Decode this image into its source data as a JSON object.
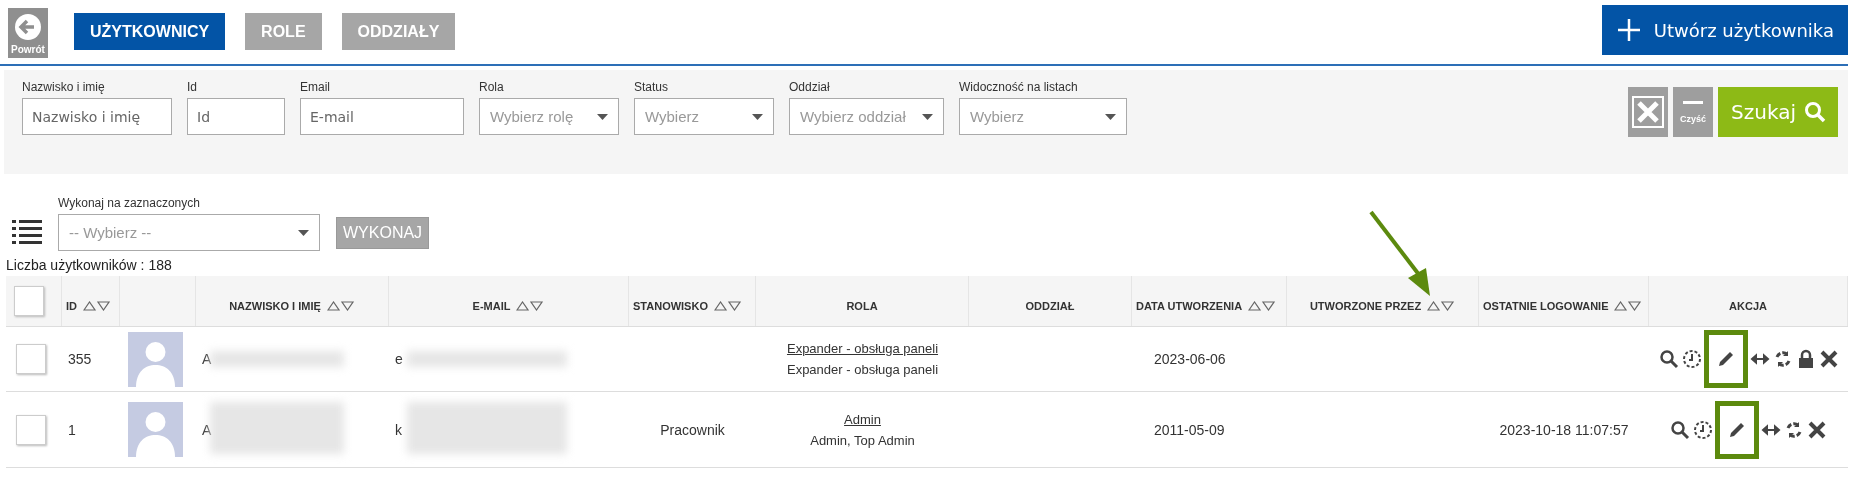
{
  "back_button": {
    "label": "Powrót"
  },
  "nav_tabs": [
    {
      "label": "UŻYTKOWNICY",
      "selected": true
    },
    {
      "label": "ROLE",
      "selected": false
    },
    {
      "label": "ODDZIAŁY",
      "selected": false
    }
  ],
  "create_button": {
    "label": "Utwórz użytkownika"
  },
  "filters": [
    {
      "kind": "text",
      "label": "Nazwisko i imię",
      "placeholder": "Nazwisko i imię"
    },
    {
      "kind": "text",
      "label": "Id",
      "placeholder": "Id"
    },
    {
      "kind": "text",
      "label": "Email",
      "placeholder": "E-mail"
    },
    {
      "kind": "select",
      "label": "Rola",
      "placeholder": "Wybierz rolę"
    },
    {
      "kind": "select",
      "label": "Status",
      "placeholder": "Wybierz"
    },
    {
      "kind": "select",
      "label": "Oddział",
      "placeholder": "Wybierz oddział"
    },
    {
      "kind": "select",
      "label": "Widoczność na listach",
      "placeholder": "Wybierz"
    }
  ],
  "clear_button": {
    "label": "Czyść"
  },
  "search_button": {
    "label": "Szukaj"
  },
  "bulk_action": {
    "label": "Wykonaj na zaznaczonych",
    "placeholder": "-- Wybierz --",
    "button": "WYKONAJ"
  },
  "user_count": "Liczba użytkowników : 188",
  "table": {
    "columns": [
      {
        "kind": "checkbox",
        "sortable": false,
        "checked": false
      },
      {
        "kind": "text",
        "label": "ID",
        "sortable": true
      },
      {
        "kind": "avatar",
        "sortable": false
      },
      {
        "kind": "text",
        "label": "NAZWISKO I IMIĘ",
        "sortable": true
      },
      {
        "kind": "text",
        "label": "E-MAIL",
        "sortable": true
      },
      {
        "kind": "text",
        "label": "STANOWISKO",
        "sortable": true
      },
      {
        "kind": "text",
        "label": "ROLA",
        "sortable": false
      },
      {
        "kind": "text",
        "label": "ODDZIAŁ",
        "sortable": false
      },
      {
        "kind": "text",
        "label": "DATA UTWORZENIA",
        "sortable": true
      },
      {
        "kind": "text",
        "label": "UTWORZONE PRZEZ",
        "sortable": true
      },
      {
        "kind": "text",
        "label": "OSTATNIE LOGOWANIE",
        "sortable": true
      },
      {
        "kind": "text",
        "label": "AKCJA",
        "sortable": false
      }
    ],
    "rows": [
      {
        "checked": false,
        "id": "355",
        "name": "A",
        "email": "e",
        "position": "",
        "role_link": "Expander - obsługa paneli",
        "roles": "Expander - obsługa paneli",
        "created": "2023-06-06",
        "last_login": "",
        "actions": [
          {
            "kind": "search",
            "highlighted": false
          },
          {
            "kind": "history",
            "highlighted": false
          },
          {
            "kind": "edit",
            "highlighted": true
          },
          {
            "kind": "transfer",
            "highlighted": false
          },
          {
            "kind": "reset",
            "highlighted": false
          },
          {
            "kind": "lock",
            "highlighted": false
          },
          {
            "kind": "delete",
            "highlighted": false
          }
        ]
      },
      {
        "checked": false,
        "id": "1",
        "name": "A",
        "email": "k",
        "position": "Pracownik",
        "role_link": "Admin",
        "roles": "Admin, Top Admin",
        "created": "2011-05-09",
        "last_login": "2023-10-18 11:07:57",
        "actions": [
          {
            "kind": "search",
            "highlighted": false
          },
          {
            "kind": "history",
            "highlighted": false
          },
          {
            "kind": "edit",
            "highlighted": true
          },
          {
            "kind": "transfer",
            "highlighted": false
          },
          {
            "kind": "reset",
            "highlighted": false
          },
          {
            "kind": "delete",
            "highlighted": false
          }
        ]
      }
    ]
  }
}
